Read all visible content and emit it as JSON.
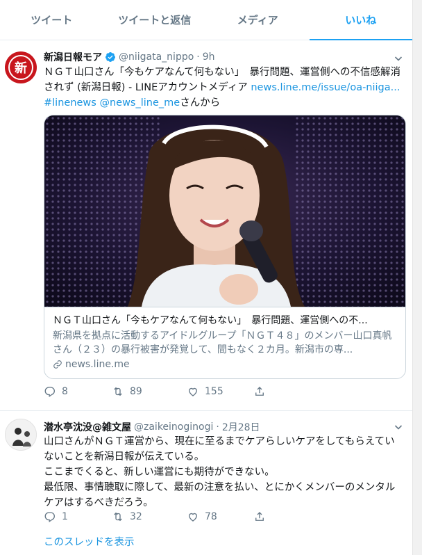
{
  "tabs": [
    {
      "label": "ツイート"
    },
    {
      "label": "ツイートと返信"
    },
    {
      "label": "メディア"
    },
    {
      "label": "いいね"
    }
  ],
  "tweets": [
    {
      "name": "新潟日報モア",
      "handle": "@niigata_nippo",
      "separator": "·",
      "time": "9h",
      "avatar_glyph": "新",
      "text_plain": "ＮＧＴ山口さん「今もケアなんて何もない」　暴行問題、運営側への不信感解消されず (新潟日報) - LINEアカウントメディア ",
      "text_link": "news.line.me/issue/oa-niiga...",
      "text_hashtag": " #linenews",
      "text_mention": " @news_line_me",
      "text_suffix": "さんから",
      "card": {
        "title": "ＮＧＴ山口さん「今もケアなんて何もない」　暴行問題、運営側への不...",
        "description": "新潟県を拠点に活動するアイドルグループ「ＮＧＴ４８」のメンバー山口真帆さん（２３）の暴行被害が発覚して、間もなく２カ月。新潟市の専...",
        "domain": "news.line.me"
      },
      "replies": "8",
      "retweets": "89",
      "likes": "155"
    },
    {
      "name": "潜水亭沈没@雑文屋",
      "handle": "@zaikeinoginogi",
      "separator": "·",
      "time": "2月28日",
      "text_lines": [
        "山口さんがＮＧＴ運営から、現在に至るまでケアらしいケアをしてもらえていないことを新潟日報が伝えている。",
        "ここまでくると、新しい運営にも期待ができない。",
        "最低限、事情聴取に際して、最新の注意を払い、とにかくメンバーのメンタルケアはするべきだろう。"
      ],
      "replies": "1",
      "retweets": "32",
      "likes": "78",
      "show_thread": "このスレッドを表示"
    }
  ],
  "colors": {
    "accent": "#1da1f2",
    "link": "#1b95e0",
    "secondary_text": "#657786",
    "avatar_red": "#c8161d"
  },
  "icons": [
    "verified-badge-icon",
    "chevron-down-icon",
    "reply-icon",
    "retweet-icon",
    "like-icon",
    "share-icon",
    "link-icon"
  ]
}
